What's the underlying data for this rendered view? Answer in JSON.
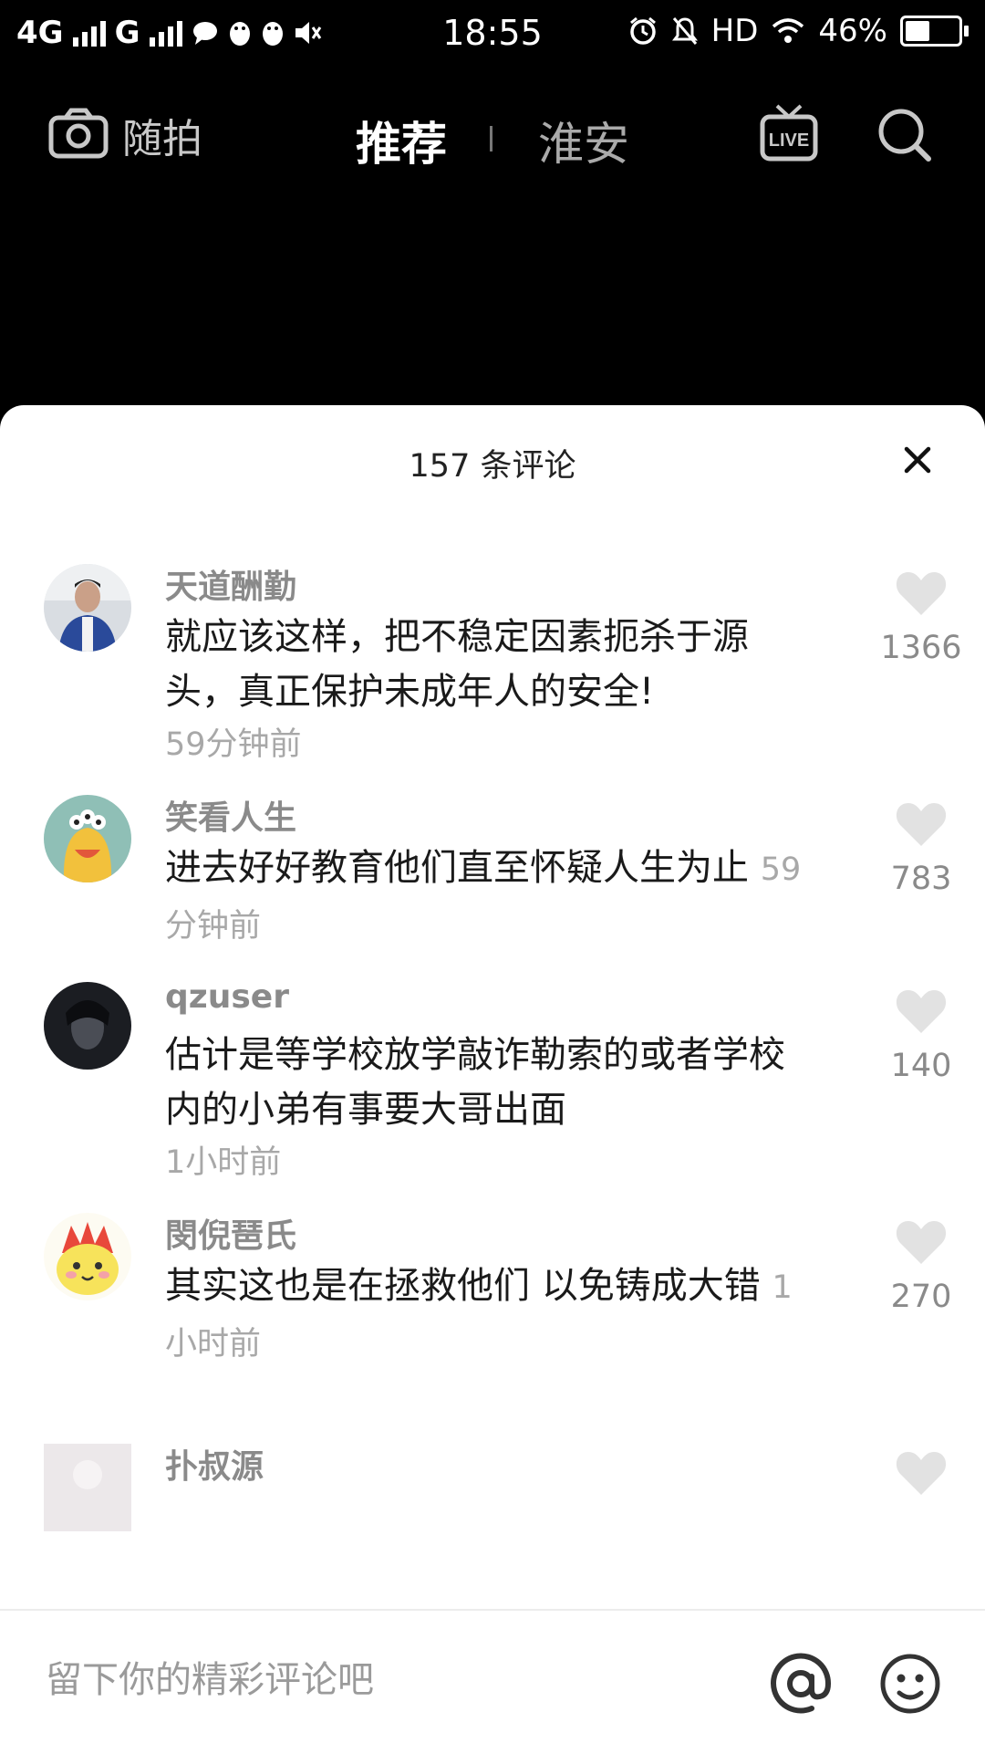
{
  "status_bar": {
    "network1": "4G",
    "network2": "G",
    "time": "18:55",
    "hd": "HD",
    "battery_text": "46%",
    "battery_level": 0.46
  },
  "top_nav": {
    "camera_label": "随拍",
    "tab_recommend": "推荐",
    "tab_city": "淮安"
  },
  "comments_sheet": {
    "title": "157 条评论",
    "comments": [
      {
        "user": "天道酬勤",
        "text": "就应该这样，把不稳定因素扼杀于源头，真正保护未成年人的安全!",
        "time": "59分钟前",
        "likes": "1366"
      },
      {
        "user": "笑看人生",
        "text": "进去好好教育他们直至怀疑人生为止",
        "time": "59分钟前",
        "likes": "783"
      },
      {
        "user": "qzuser",
        "text": "估计是等学校放学敲诈勒索的或者学校内的小弟有事要大哥出面",
        "time": "1小时前",
        "likes": "140"
      },
      {
        "user": "閔倪琶氏",
        "text": "其实这也是在拯救他们 以免铸成大错",
        "time": "1小时前",
        "likes": "270"
      },
      {
        "user": "扑叔源",
        "text": "",
        "time": "",
        "likes": ""
      }
    ]
  },
  "input": {
    "placeholder": "留下你的精彩评论吧",
    "value": ""
  },
  "icons": {
    "camera": "camera-icon",
    "live": "live-tv-icon",
    "search": "search-icon",
    "close": "close-icon",
    "like": "heart-icon",
    "at": "at-icon",
    "emoji": "emoji-icon"
  },
  "colors": {
    "background": "#000000",
    "sheet": "#ffffff",
    "muted_text": "#8a8a8a",
    "heart": "#e0e0e0"
  }
}
